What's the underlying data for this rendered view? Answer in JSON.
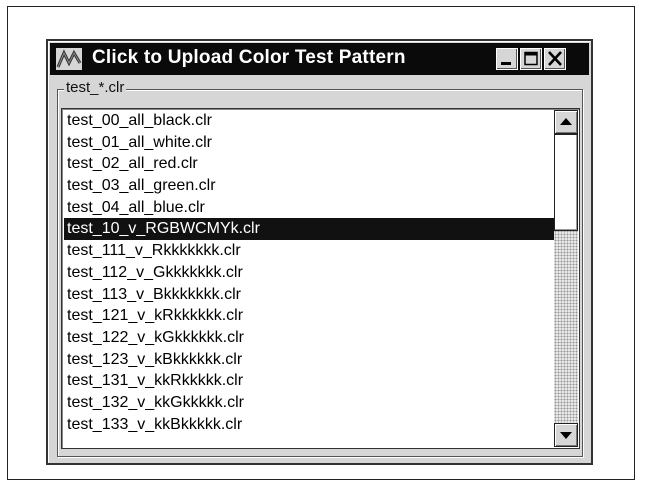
{
  "window": {
    "title": "Click to Upload Color Test Pattern",
    "app_icon": "waveform-app-icon",
    "controls": {
      "minimize": "minimize-icon",
      "maximize": "maximize-icon",
      "close": "close-icon"
    }
  },
  "file_group": {
    "label": "test_*.clr"
  },
  "file_list": {
    "selected_index": 5,
    "items": [
      "test_00_all_black.clr",
      "test_01_all_white.clr",
      "test_02_all_red.clr",
      "test_03_all_green.clr",
      "test_04_all_blue.clr",
      "test_10_v_RGBWCMYk.clr",
      "test_111_v_Rkkkkkkk.clr",
      "test_112_v_Gkkkkkkk.clr",
      "test_113_v_Bkkkkkkk.clr",
      "test_121_v_kRkkkkkk.clr",
      "test_122_v_kGkkkkkk.clr",
      "test_123_v_kBkkkkkk.clr",
      "test_131_v_kkRkkkkk.clr",
      "test_132_v_kkGkkkkk.clr",
      "test_133_v_kkBkkkkk.clr"
    ]
  },
  "scrollbar": {
    "up": "arrow-up-icon",
    "down": "arrow-down-icon"
  },
  "colors": {
    "titlebar": "#0a0a0a",
    "window_face": "#d6d6d6",
    "selection": "#111111"
  }
}
